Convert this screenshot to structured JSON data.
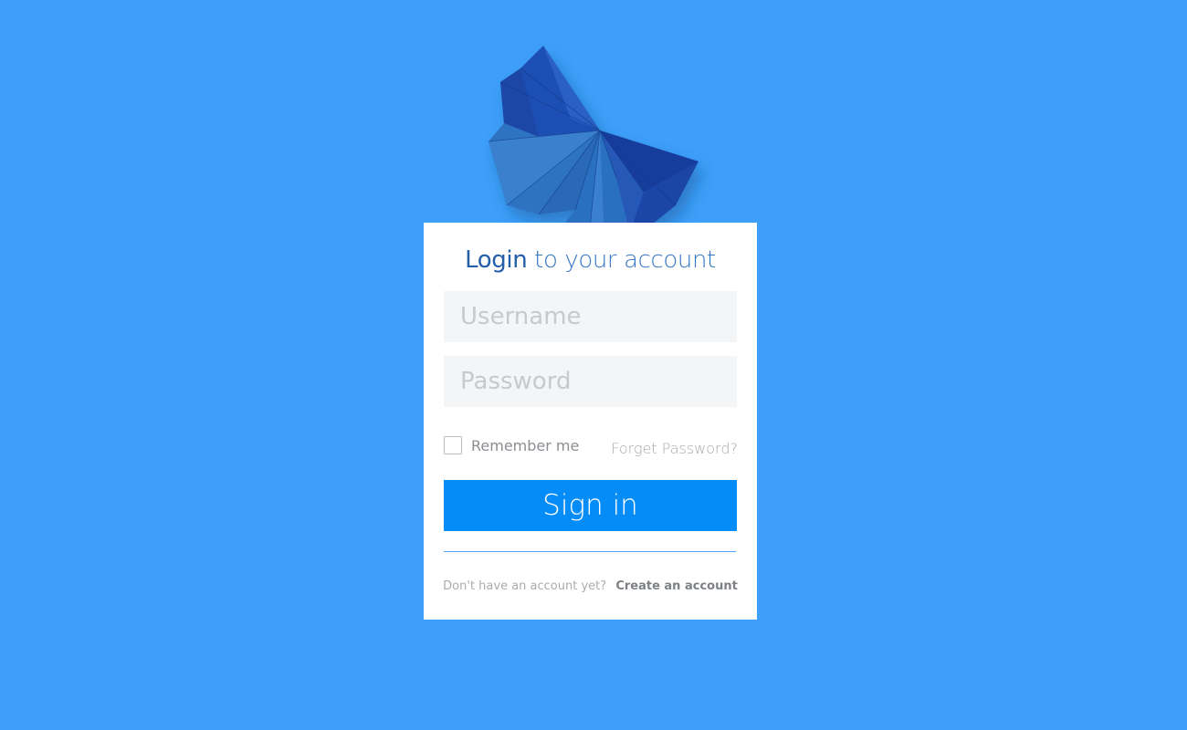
{
  "brand": {
    "logo_icon": "origami-butterfly-icon",
    "colors": {
      "background": "#3d9ff9",
      "card": "#ffffff",
      "accent": "#048cf8",
      "title": "#235ea8"
    }
  },
  "login": {
    "title_strong": "Login",
    "title_rest": "to your account",
    "username_placeholder": "Username",
    "password_placeholder": "Password",
    "remember_label": "Remember me",
    "remember_checked": false,
    "forgot_label": "Forget Password?",
    "signin_label": "Sign in",
    "footer_question": "Don't have an account yet?",
    "create_account_label": "Create an account"
  }
}
